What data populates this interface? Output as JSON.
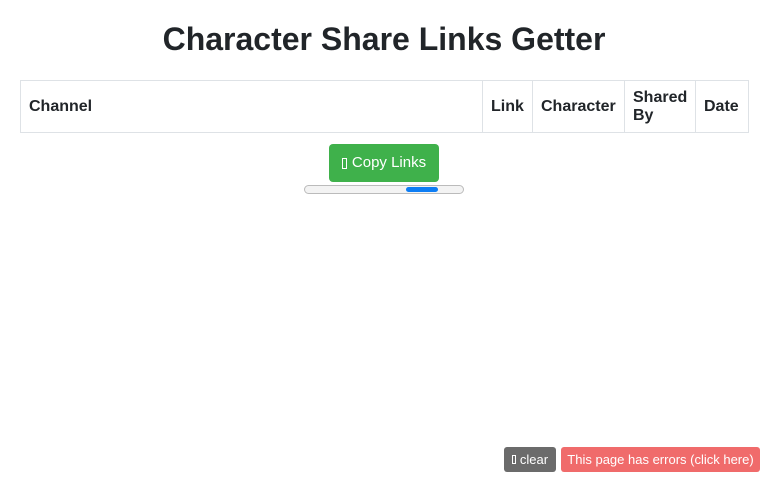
{
  "page": {
    "title": "Character Share Links Getter"
  },
  "table": {
    "headers": {
      "channel": "Channel",
      "link": "Link",
      "character": "Character",
      "shared_by": "Shared By",
      "date": "Date"
    },
    "rows": []
  },
  "actions": {
    "copy_label": "Copy Links",
    "copy_icon": "copy-icon",
    "copy_color": "#3fb14b"
  },
  "progress": {
    "indeterminate": true,
    "segment_start": 0.64,
    "segment_width": 0.2,
    "color": "#0d7df4"
  },
  "debug_bar": {
    "clear_label": "clear",
    "clear_icon": "trash-icon",
    "error_label": "This page has errors (click here)",
    "error_color": "#f06b6b"
  }
}
